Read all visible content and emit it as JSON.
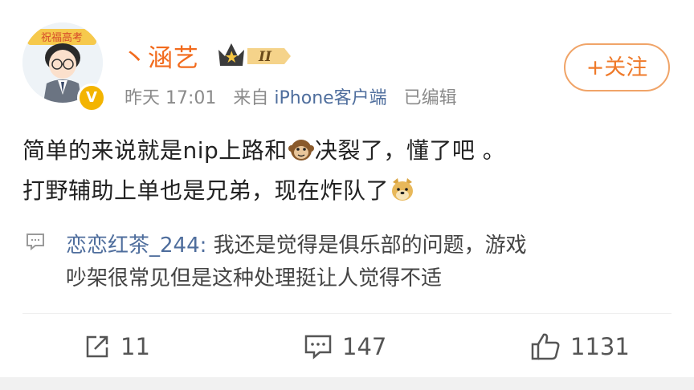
{
  "post": {
    "username": "丶涵艺",
    "level_badge": "II",
    "time": "昨天 17:01",
    "source_prefix": "来自",
    "source": "iPhone客户端",
    "edited": "已编辑",
    "follow_label": "+关注",
    "body_line1_a": "简单的来说就是nip上路和",
    "body_line1_b": "决裂了，懂了吧 。",
    "body_line2": "打野辅助上单也是兄弟，现在炸队了",
    "emojis": [
      "monkey-emoji",
      "doge-emoji"
    ],
    "avatar_banner": "祝福高考"
  },
  "comment": {
    "author": "恋恋红茶_244",
    "separator": ":",
    "text_line1": "我还是觉得是俱乐部的问题，游戏",
    "text_line2": "吵架很常见但是这种处理挺让人觉得不适"
  },
  "actions": {
    "shares": "11",
    "comments": "147",
    "likes": "1131"
  },
  "colors": {
    "username": "#f26b1d",
    "link": "#4f6e9d",
    "follow": "#ef7a2a",
    "meta": "#8a8a8a"
  }
}
